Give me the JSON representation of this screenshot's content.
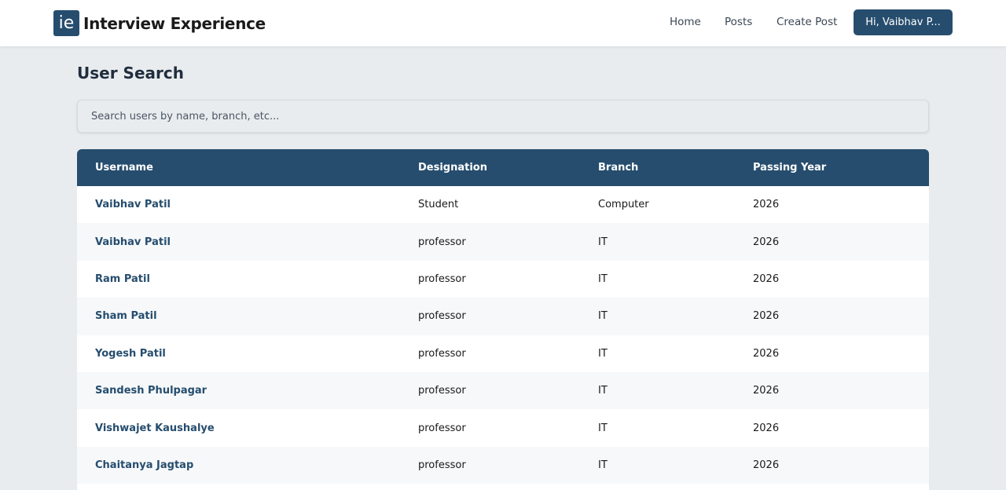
{
  "brand": {
    "logo_text": "ie",
    "name": "Interview Experience"
  },
  "nav": {
    "home": "Home",
    "posts": "Posts",
    "create_post": "Create Post",
    "user_button": "Hi, Vaibhav P..."
  },
  "page": {
    "title": "User Search",
    "search_placeholder": "Search users by name, branch, etc..."
  },
  "table": {
    "headers": [
      "Username",
      "Designation",
      "Branch",
      "Passing Year"
    ],
    "rows": [
      [
        "Vaibhav Patil",
        "Student",
        "Computer",
        "2026"
      ],
      [
        "Vaibhav Patil",
        "professor",
        "IT",
        "2026"
      ],
      [
        "Ram Patil",
        "professor",
        "IT",
        "2026"
      ],
      [
        "Sham Patil",
        "professor",
        "IT",
        "2026"
      ],
      [
        "Yogesh Patil",
        "professor",
        "IT",
        "2026"
      ],
      [
        "Sandesh Phulpagar",
        "professor",
        "IT",
        "2026"
      ],
      [
        "Vishwajet Kaushalye",
        "professor",
        "IT",
        "2026"
      ],
      [
        "Chaitanya Jagtap",
        "professor",
        "IT",
        "2026"
      ]
    ]
  },
  "colors": {
    "primary": "#264d6e",
    "background": "#e9ecef",
    "navbar": "#ffffff"
  }
}
